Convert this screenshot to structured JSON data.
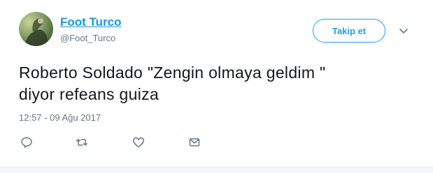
{
  "author": {
    "name": "Foot Turco",
    "handle": "@Foot_Turco"
  },
  "follow_button": {
    "label": "Takip et"
  },
  "tweet": {
    "text_line1": "Roberto Soldado \"Zengin olmaya geldim \"",
    "text_line2": "diyor refeans guiza",
    "timestamp": "12:57 - 09 Ağu 2017"
  },
  "actions": [
    {
      "icon": "reply-icon"
    },
    {
      "icon": "retweet-icon"
    },
    {
      "icon": "heart-icon"
    },
    {
      "icon": "message-icon"
    }
  ],
  "colors": {
    "link_blue": "#1b95e0",
    "accent_blue": "#1da1f2",
    "secondary_text": "#657786",
    "primary_text": "#14171a"
  }
}
